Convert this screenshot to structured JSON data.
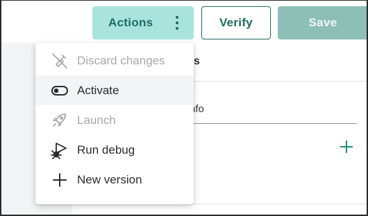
{
  "toolbar": {
    "actions_label": "Actions",
    "verify_label": "Verify",
    "save_label": "Save"
  },
  "page": {
    "title_fragment": "s",
    "field_fragment": "nfo"
  },
  "actions_menu": {
    "items": [
      {
        "label": "Discard changes",
        "icon": "discard-icon",
        "disabled": true
      },
      {
        "label": "Activate",
        "icon": "toggle-icon",
        "disabled": false,
        "hovered": true
      },
      {
        "label": "Launch",
        "icon": "rocket-icon",
        "disabled": true
      },
      {
        "label": "Run debug",
        "icon": "debug-icon",
        "disabled": false
      },
      {
        "label": "New version",
        "icon": "plus-icon",
        "disabled": false
      }
    ]
  },
  "colors": {
    "accent": "#1f6b63",
    "actions_bg": "#a8e4dc",
    "save_bg": "#8dbfb7",
    "disabled_text": "#a7a7a7"
  }
}
